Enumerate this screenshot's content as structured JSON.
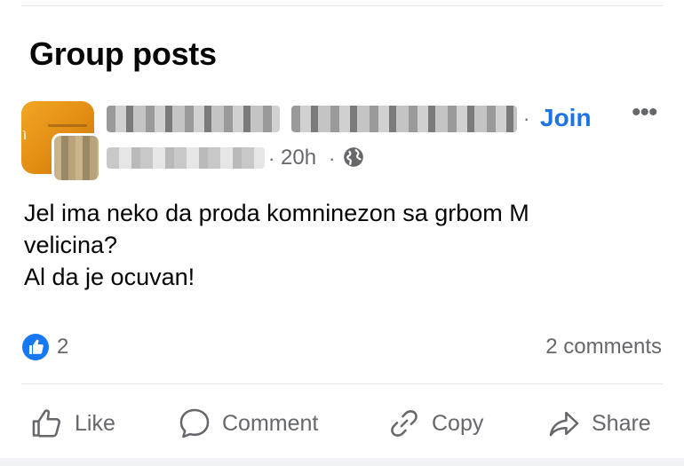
{
  "section": {
    "title": "Group posts"
  },
  "post": {
    "join_label": "Join",
    "more_label": "•••",
    "separator": "·",
    "time": "20h",
    "text_lines": [
      "Jel ima neko da proda komninezon sa grbom M",
      "velicina?",
      "Al da je ocuvan!"
    ],
    "like_count": "2",
    "comments_count": "2 comments"
  },
  "actions": {
    "like": "Like",
    "comment": "Comment",
    "copy": "Copy",
    "share": "Share"
  },
  "icons": {
    "globe": "globe-icon",
    "like_reaction": "thumbs-up-reaction-icon",
    "like": "thumbs-up-icon",
    "comment": "speech-bubble-icon",
    "copy": "link-icon",
    "share": "share-arrow-icon"
  },
  "colors": {
    "accent": "#1b74e4",
    "secondary_text": "#65676b",
    "reaction_blue": "#1877f2"
  }
}
